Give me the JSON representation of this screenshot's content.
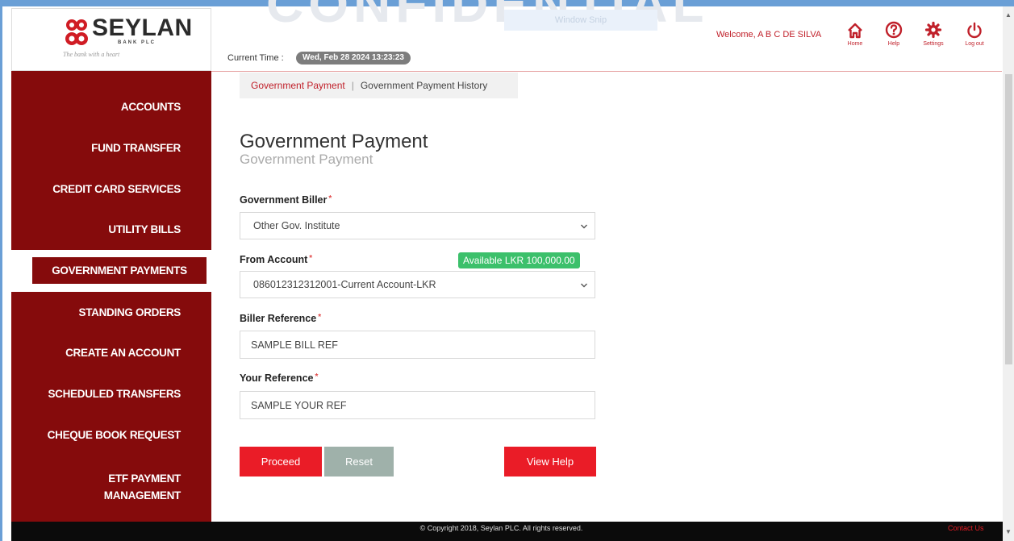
{
  "watermark": "CONFIDENTIAL",
  "window_snip": "Window Snip",
  "brand": {
    "name": "SEYLAN",
    "sub": "BANK PLC",
    "tagline": "The bank with a heart"
  },
  "header": {
    "current_time_label": "Current Time :",
    "current_time_value": "Wed, Feb 28 2024 13:23:23",
    "welcome": "Welcome, A B C DE SILVA",
    "actions": [
      {
        "label": "Home",
        "icon": "home-icon"
      },
      {
        "label": "Help",
        "icon": "help-icon"
      },
      {
        "label": "Settings",
        "icon": "gear-icon"
      },
      {
        "label": "Log out",
        "icon": "power-icon"
      }
    ]
  },
  "sidebar": {
    "items": [
      {
        "label": "ACCOUNTS"
      },
      {
        "label": "FUND TRANSFER"
      },
      {
        "label": "CREDIT CARD SERVICES"
      },
      {
        "label": "UTILITY BILLS"
      },
      {
        "label": "GOVERNMENT PAYMENTS",
        "active": true
      },
      {
        "label": "STANDING ORDERS"
      },
      {
        "label": "CREATE AN ACCOUNT"
      },
      {
        "label": "SCHEDULED TRANSFERS"
      },
      {
        "label": "CHEQUE BOOK REQUEST"
      },
      {
        "label_line1": "ETF PAYMENT",
        "label_line2": "MANAGEMENT"
      }
    ]
  },
  "breadcrumb": {
    "active": "Government Payment",
    "separator": "|",
    "link": "Government Payment History"
  },
  "page": {
    "title": "Government Payment",
    "subtitle": "Government Payment"
  },
  "form": {
    "biller_label": "Government Biller",
    "biller_value": "Other Gov. Institute",
    "from_account_label": "From Account",
    "available_badge": "Available LKR 100,000.00",
    "from_account_value": "086012312312001-Current Account-LKR",
    "biller_ref_label": "Biller Reference",
    "biller_ref_value": "SAMPLE BILL REF",
    "your_ref_label": "Your Reference",
    "your_ref_value": "SAMPLE YOUR REF",
    "required_mark": "*"
  },
  "buttons": {
    "proceed": "Proceed",
    "reset": "Reset",
    "view_help": "View Help"
  },
  "footer": {
    "copyright": "© Copyright 2018, Seylan PLC. All rights reserved.",
    "contact": "Contact Us"
  },
  "colors": {
    "brand_red": "#850b0c",
    "accent_red": "#ea1c27",
    "success": "#3cc06b"
  }
}
